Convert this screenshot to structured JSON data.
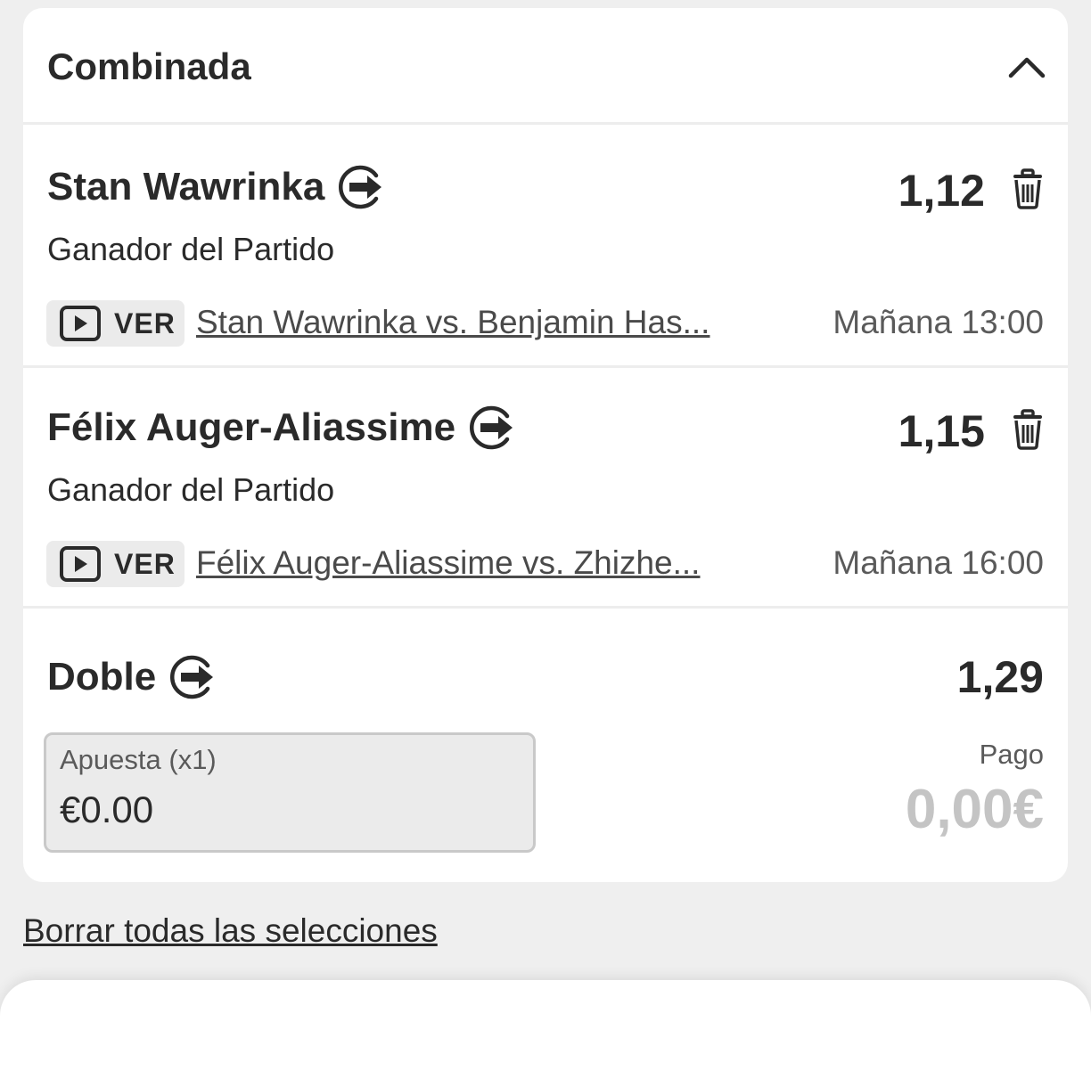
{
  "betslip": {
    "title": "Combinada",
    "selections": [
      {
        "name": "Stan Wawrinka",
        "odds": "1,12",
        "market": "Ganador del Partido",
        "watch_label": "VER",
        "event": "Stan Wawrinka vs. Benjamin Has...",
        "time": "Mañana 13:00"
      },
      {
        "name": "Félix Auger-Aliassime",
        "odds": "1,15",
        "market": "Ganador del Partido",
        "watch_label": "VER",
        "event": "Félix Auger-Aliassime vs. Zhizhe...",
        "time": "Mañana 16:00"
      }
    ],
    "combo": {
      "name": "Doble",
      "odds": "1,29",
      "stake_label": "Apuesta (x1)",
      "stake_value": "€0.00",
      "payout_label": "Pago",
      "payout_value": "0,00€"
    }
  },
  "footer": {
    "clear_all": "Borrar todas las selecciones"
  },
  "icons": {
    "collapse": "chevron-up-icon",
    "cashout": "cashout-icon",
    "delete": "trash-icon",
    "watch": "play-video-icon"
  },
  "colors": {
    "background": "#efefef",
    "card": "#ffffff",
    "text": "#2a2a2a",
    "muted": "#5a5a5a",
    "payout_disabled": "#c4c4c4"
  }
}
